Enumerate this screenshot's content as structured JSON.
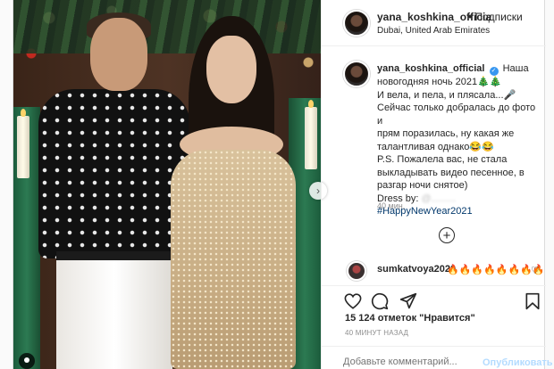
{
  "header": {
    "username": "yana_koshkina_officia",
    "follow_label": "• Подписки",
    "location": "Dubai, United Arab Emirates",
    "more_label": "⋯"
  },
  "caption": {
    "username": "yana_koshkina_official",
    "verified_glyph": "✓",
    "text_first": "Наша",
    "lines": [
      "новогодняя ночь 2021🎄🎄",
      "И вела, и пела, и плясала...🎤",
      "Сейчас только добралась до фото и",
      "прям поразилась, ну какая же",
      "талантливая однако😂😂",
      "P.S. Пожалела вас, не стала",
      "выкладывать видео песенное, в",
      "разгар ночи снятое)"
    ],
    "dress_label": "Dress by:",
    "dress_tag": "@.........",
    "hashtag": "#HappyNewYear2021",
    "time": "40 мин."
  },
  "load_more": "+",
  "comment": {
    "username": "sumkatvoya2020",
    "text": "🔥🔥🔥🔥🔥🔥🔥🔥",
    "like_glyph": "♡"
  },
  "actions": {
    "like": "heart-icon",
    "comment": "comment-icon",
    "share": "share-icon",
    "save": "bookmark-icon"
  },
  "likes": "15 124 отметок \"Нравится\"",
  "post_time": "40 МИНУТ НАЗАД",
  "add_comment": {
    "placeholder": "Добавьте комментарий...",
    "publish_label": "Опубликовать"
  },
  "carousel_next": "›",
  "colors": {
    "link": "#00376b",
    "verified": "#3897f0",
    "publish_disabled": "#b3dbff",
    "muted": "#8e8e8e"
  }
}
